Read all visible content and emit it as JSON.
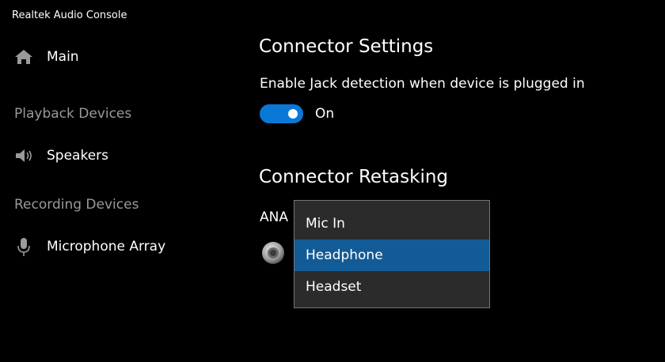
{
  "window": {
    "title": "Realtek Audio Console"
  },
  "sidebar": {
    "main": {
      "label": "Main",
      "icon": "home-icon"
    },
    "playback_section": "Playback Devices",
    "speakers": {
      "label": "Speakers",
      "icon": "speaker-icon"
    },
    "recording_section": "Recording Devices",
    "microphone": {
      "label": "Microphone Array",
      "icon": "microphone-icon"
    }
  },
  "content": {
    "connector_settings_title": "Connector Settings",
    "jack_detection_label": "Enable Jack detection when device is plugged in",
    "jack_detection_state": "On",
    "connector_retasking_title": "Connector Retasking",
    "analog_label": "ANA",
    "jack_icon": "audio-jack-icon"
  },
  "dropdown": {
    "options": [
      "Mic In",
      "Headphone",
      "Headset"
    ],
    "selected": "Headphone"
  },
  "colors": {
    "background": "#000000",
    "accent": "#0a78d7",
    "selected_item": "#135b96",
    "menu_background": "#2b2b2b",
    "secondary_text": "#9a9a9a"
  }
}
